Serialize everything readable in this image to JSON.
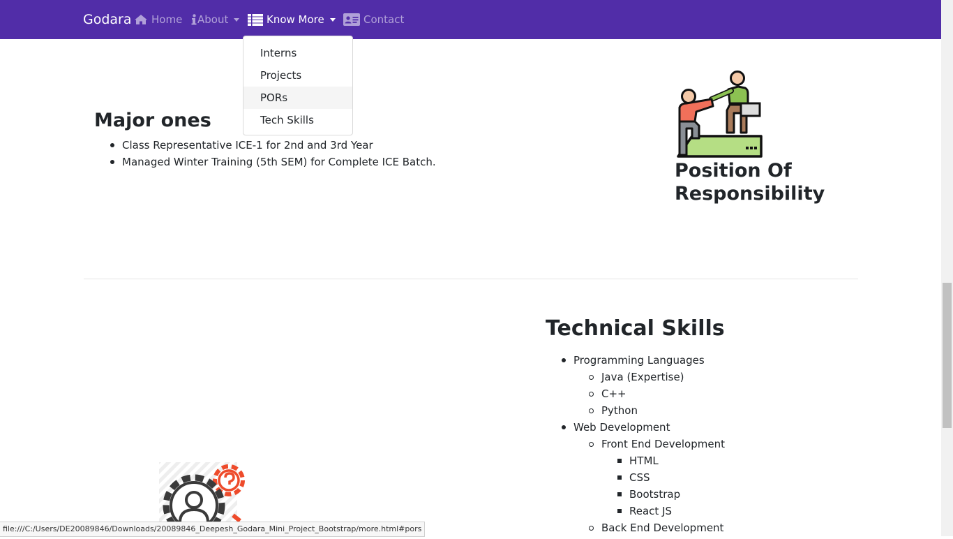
{
  "navbar": {
    "brand": "Godara",
    "links": [
      {
        "label": "Home",
        "icon": "home-icon"
      },
      {
        "label": "About",
        "icon": "info-icon"
      },
      {
        "label": "Know More",
        "icon": "list-icon"
      },
      {
        "label": "Contact",
        "icon": "contact-card-icon"
      }
    ],
    "dropdown": [
      "Interns",
      "Projects",
      "PORs",
      "Tech Skills"
    ],
    "colors": {
      "background": "#512da8",
      "active": "#ffffff"
    }
  },
  "por_section": {
    "heading": "Major ones",
    "items": [
      "Class Representative ICE-1 for 2nd and 3rd Year",
      "Managed Winter Training (5th SEM) for Complete ICE Batch."
    ],
    "title": "Position Of Responsibility",
    "illustration": "teamwork-help-icon"
  },
  "tech_section": {
    "title": "Technical Skills",
    "programming": {
      "label": "Programming Languages",
      "items": [
        "Java (Expertise)",
        "C++",
        "Python"
      ]
    },
    "web": {
      "label": "Web Development",
      "front": {
        "label": "Front End Development",
        "items": [
          "HTML",
          "CSS",
          "Bootstrap",
          "React JS"
        ]
      },
      "back": {
        "label": "Back End Development"
      }
    },
    "illustration": "gear-user-icon"
  },
  "status_bar": {
    "url": "file:///C:/Users/DE20089846/Downloads/20089846_Deepesh_Godara_Mini_Project_Bootstrap/more.html#pors"
  }
}
